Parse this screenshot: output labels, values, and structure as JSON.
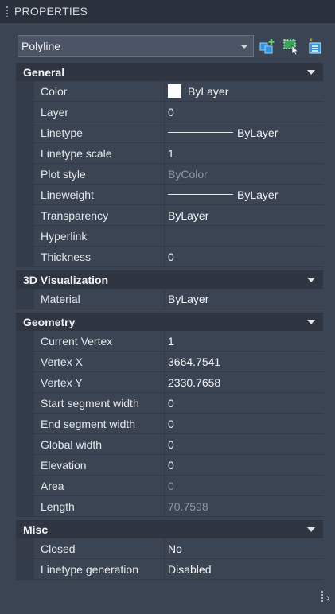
{
  "panel": {
    "title": "PROPERTIES"
  },
  "object_selector": {
    "value": "Polyline"
  },
  "toolbar": {
    "buttons": [
      "toggle-pickadd-icon",
      "select-objects-icon",
      "quick-select-icon"
    ],
    "accent": "#2f95e0"
  },
  "sections": {
    "general": {
      "title": "General",
      "rows": [
        {
          "name": "Color",
          "value": "ByLayer"
        },
        {
          "name": "Layer",
          "value": "0"
        },
        {
          "name": "Linetype",
          "value": "ByLayer"
        },
        {
          "name": "Linetype scale",
          "value": "1"
        },
        {
          "name": "Plot style",
          "value": "ByColor"
        },
        {
          "name": "Lineweight",
          "value": "ByLayer"
        },
        {
          "name": "Transparency",
          "value": "ByLayer"
        },
        {
          "name": "Hyperlink",
          "value": ""
        },
        {
          "name": "Thickness",
          "value": "0"
        }
      ]
    },
    "viz3d": {
      "title": "3D Visualization",
      "rows": [
        {
          "name": "Material",
          "value": "ByLayer"
        }
      ]
    },
    "geometry": {
      "title": "Geometry",
      "rows": [
        {
          "name": "Current Vertex",
          "value": "1"
        },
        {
          "name": "Vertex X",
          "value": "3664.7541"
        },
        {
          "name": "Vertex Y",
          "value": "2330.7658"
        },
        {
          "name": "Start segment width",
          "value": "0"
        },
        {
          "name": "End segment width",
          "value": "0"
        },
        {
          "name": "Global width",
          "value": "0"
        },
        {
          "name": "Elevation",
          "value": "0"
        },
        {
          "name": "Area",
          "value": "0"
        },
        {
          "name": "Length",
          "value": "70.7598"
        }
      ]
    },
    "misc": {
      "title": "Misc",
      "rows": [
        {
          "name": "Closed",
          "value": "No"
        },
        {
          "name": "Linetype generation",
          "value": "Disabled"
        }
      ]
    }
  }
}
